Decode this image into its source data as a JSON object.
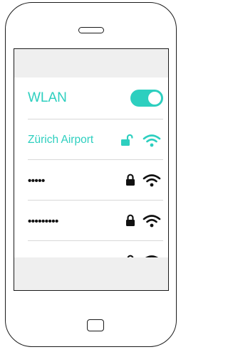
{
  "wifi": {
    "title": "WLAN",
    "toggle_on": true,
    "connected_network": "Zürich Airport",
    "networks": [
      {
        "name": "•••••",
        "locked": true
      },
      {
        "name": "•••••••••",
        "locked": true
      },
      {
        "name": "•••••••",
        "locked": true
      }
    ]
  },
  "colors": {
    "accent": "#2dcfbf",
    "text": "#111111",
    "bar": "#efefef"
  },
  "icons": {
    "open_network": "unlock-icon",
    "locked_network": "lock-icon",
    "signal": "wifi-icon"
  }
}
